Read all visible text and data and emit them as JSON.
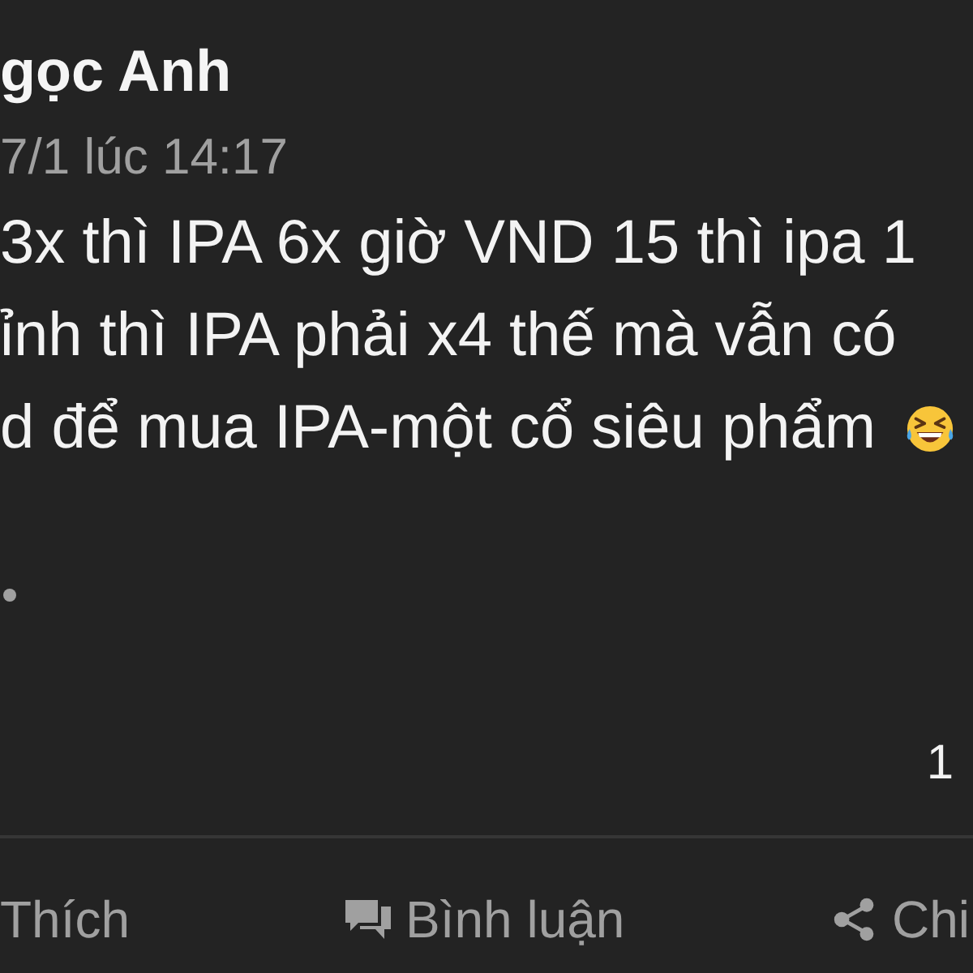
{
  "post": {
    "author": "gọc Anh",
    "timestamp": "7/1 lúc 14:17",
    "text_lines": [
      "3x thì IPA 6x giờ VND 15 thì ipa 1",
      "ỉnh thì IPA phải x4 thế mà vẫn có",
      "d để mua IPA-một cổ siêu phẩm"
    ],
    "comment_count": "1"
  },
  "actions": [
    {
      "kind": "like",
      "label": "Thích"
    },
    {
      "kind": "comment",
      "label": "Bình luận"
    },
    {
      "kind": "share",
      "label": "Chi"
    }
  ]
}
